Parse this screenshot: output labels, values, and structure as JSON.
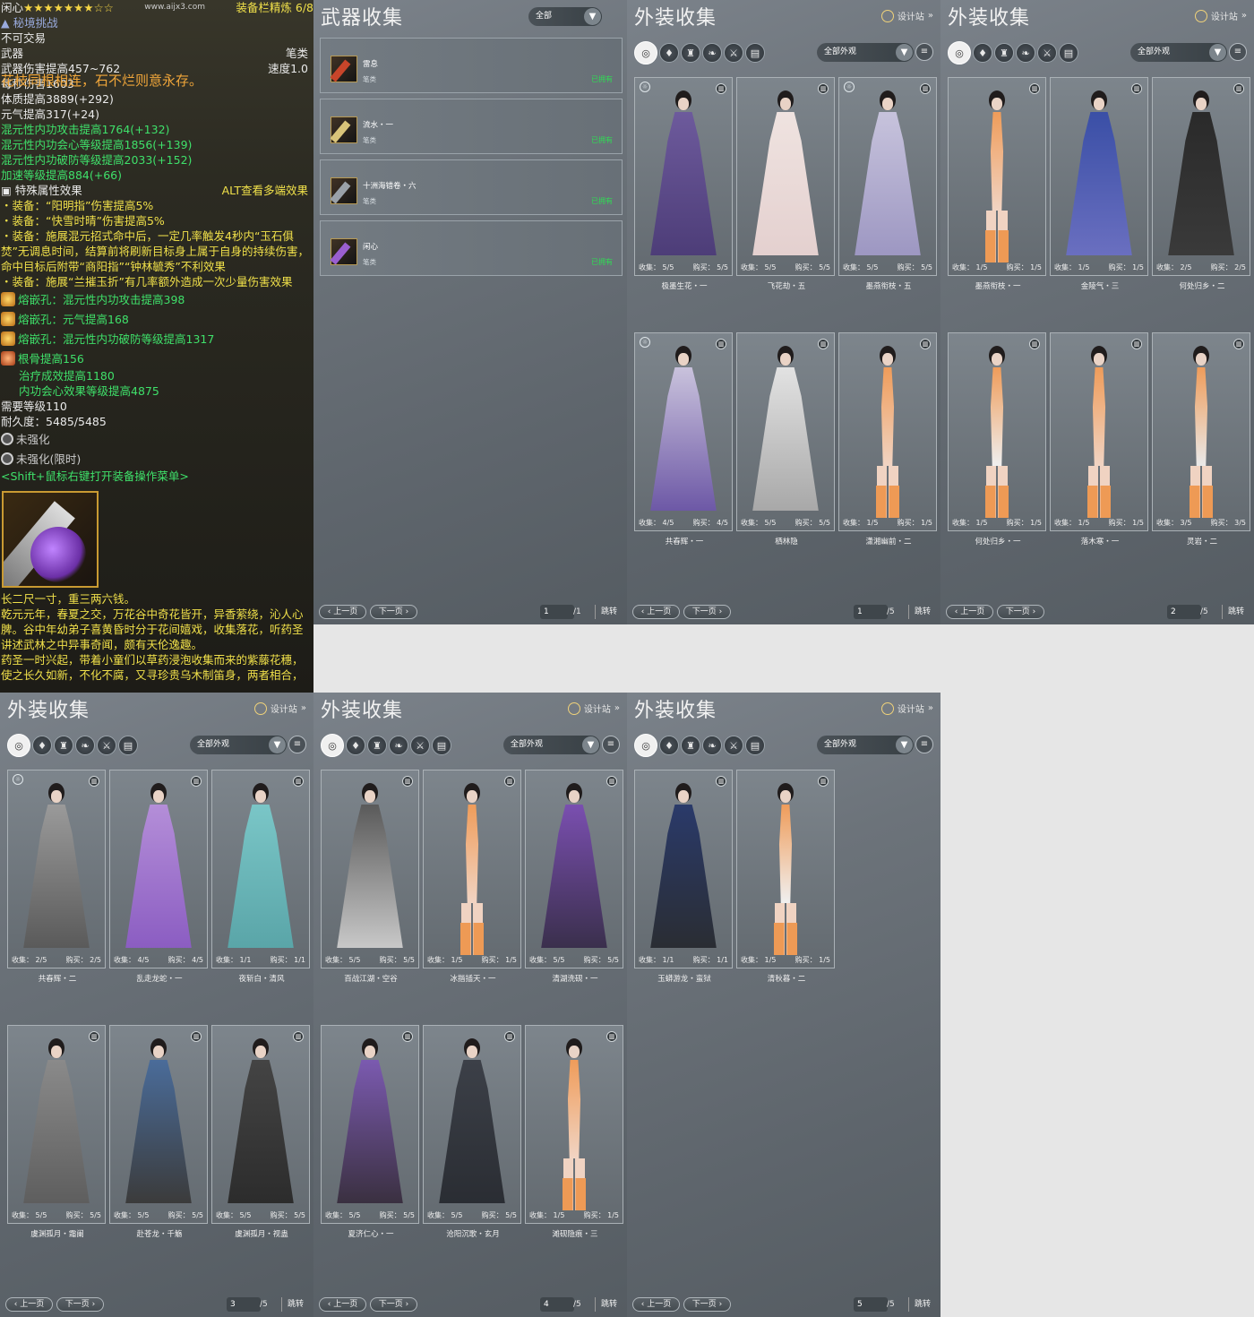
{
  "tooltip": {
    "watermark": "www.aijx3.com",
    "name": "闲心",
    "stars": "★★★★★★★☆☆",
    "refine": "装备栏精炼 6/8",
    "challenge": "秘境挑战",
    "no_trade": "不可交易",
    "slot": "武器",
    "weapon_type": "笔类",
    "damage": "武器伤害提高457~762",
    "speed": "速度1.0",
    "motto": "花枝同根相连，石不烂则意永存。",
    "dps_line": "每秒伤害1603",
    "lines": [
      {
        "text": "体质提高3889(+292)",
        "c": "w"
      },
      {
        "text": "元气提高317(+24)",
        "c": "w"
      },
      {
        "text": "混元性内功攻击提高1764(+132)",
        "c": "g"
      },
      {
        "text": "混元性内功会心等级提高1856(+139)",
        "c": "g"
      },
      {
        "text": "混元性内功破防等级提高2033(+152)",
        "c": "g"
      },
      {
        "text": "加速等级提高884(+66)",
        "c": "g"
      }
    ],
    "special_label": "特殊属性效果",
    "alt_hint": "ALT查看多端效果",
    "effects": [
      "・装备：“阳明指”伤害提高5%",
      "・装备：“快雪时晴”伤害提高5%",
      "・装备：施展混元招式命中后，一定几率触发4秒内“玉石俱焚”无调息时间，结算前将刷新目标身上属于自身的持续伤害，命中目标后附带“商阳指”“钟林毓秀”不利效果",
      "・装备：施展“兰摧玉折”有几率额外造成一次少量伤害效果"
    ],
    "gems": [
      "熔嵌孔：混元性内功攻击提高398",
      "熔嵌孔：元气提高168",
      "熔嵌孔：混元性内功破防等级提高1317"
    ],
    "enchant_main": "根骨提高156",
    "enchant_sub1": "治疗成效提高1180",
    "enchant_sub2": "内功会心效果等级提高4875",
    "level": "需要等级110",
    "durability": "耐久度：5485/5485",
    "unenhanced": "未强化",
    "unenhanced_limited": "未强化(限时)",
    "shift_hint": "<Shift+鼠标右键打开装备操作菜单>",
    "desc1": "长二尺一寸，重三两六钱。",
    "desc2": "乾元元年，春夏之交，万花谷中奇花皆开，异香萦绕，沁人心脾。谷中年幼弟子喜黄昏时分于花间嬉戏，收集落花，听药圣讲述武林之中异事奇闻，颇有天伦逸趣。",
    "desc3": "药圣一时兴起，带着小童们以草药浸泡收集而来的紫藤花穗，使之长久如新，不化不腐，又寻珍贵乌木制笛身，两者相合，"
  },
  "weapon_panel": {
    "title": "武器收集",
    "filter": "全部",
    "items": [
      {
        "name": "雷息",
        "type": "笔类",
        "status": "已拥有",
        "color": "#c8452a"
      },
      {
        "name": "流水・一",
        "type": "笔类",
        "status": "已拥有",
        "color": "#d9c47a"
      },
      {
        "name": "十洲海错卷・六",
        "type": "笔类",
        "status": "已拥有",
        "color": "#9aa1a8"
      },
      {
        "name": "闲心",
        "type": "笔类",
        "status": "已拥有",
        "color": "#9a5fd0"
      }
    ],
    "page": "1",
    "total": "/1"
  },
  "ui": {
    "designer": "设计站",
    "filter": "全部外观",
    "prev": "上一页",
    "next": "下一页",
    "jump": "跳转",
    "collect": "收集：",
    "buy": "购买："
  },
  "outfit_panels": [
    {
      "title": "外装收集",
      "page": "1",
      "total": "/5",
      "cards": [
        {
          "name": "极墨生花・一",
          "collect": "5/5",
          "buy": "5/5",
          "top": "#6d5a9c",
          "bot": "#4d3d78",
          "tl": true
        },
        {
          "name": "飞花劫・五",
          "collect": "5/5",
          "buy": "5/5",
          "top": "#efe3e0",
          "bot": "#e4d0cf",
          "tl": false
        },
        {
          "name": "墨燕衔枝・五",
          "collect": "5/5",
          "buy": "5/5",
          "top": "#c7c3dc",
          "bot": "#9d97c2",
          "tl": true
        },
        {
          "name": "共春辉・一",
          "collect": "4/5",
          "buy": "4/5",
          "top": "#c9c2dc",
          "bot": "#6d58a6",
          "tl": true
        },
        {
          "name": "栖林隐",
          "collect": "5/5",
          "buy": "5/5",
          "top": "#e2e2e2",
          "bot": "#a8a8a8",
          "tl": false
        },
        {
          "name": "潇湘幽前・二",
          "collect": "1/5",
          "buy": "1/5",
          "top": "#ef9c5a",
          "bot": "#f1d4c3",
          "tl": false,
          "slim": true
        }
      ]
    },
    {
      "title": "外装收集",
      "page": "2",
      "total": "/5",
      "cards": [
        {
          "name": "墨燕衔枝・一",
          "collect": "1/5",
          "buy": "1/5",
          "top": "#ef9c5a",
          "bot": "#f1d4c3",
          "tl": false,
          "slim": true
        },
        {
          "name": "金陵气・三",
          "collect": "1/5",
          "buy": "1/5",
          "top": "#3a4fa6",
          "bot": "#6a6fc0",
          "tl": false
        },
        {
          "name": "何处归乡・二",
          "collect": "2/5",
          "buy": "2/5",
          "top": "#2a2a2a",
          "bot": "#3a3a3a",
          "tl": false
        },
        {
          "name": "何处归乡・一",
          "collect": "1/5",
          "buy": "1/5",
          "top": "#ef9c5a",
          "bot": "#efefef",
          "tl": false,
          "slim": true
        },
        {
          "name": "落木寒・一",
          "collect": "1/5",
          "buy": "1/5",
          "top": "#ef9c5a",
          "bot": "#f1d4c3",
          "tl": false,
          "slim": true
        },
        {
          "name": "灵岩・二",
          "collect": "3/5",
          "buy": "3/5",
          "top": "#ef9c5a",
          "bot": "#e9e9e9",
          "tl": false,
          "slim": true
        }
      ]
    },
    {
      "title": "外装收集",
      "page": "3",
      "total": "/5",
      "cards": [
        {
          "name": "共春辉・二",
          "collect": "2/5",
          "buy": "2/5",
          "top": "#9a9a9a",
          "bot": "#5a5a5a",
          "tl": true
        },
        {
          "name": "乱走龙蛇・一",
          "collect": "4/5",
          "buy": "4/5",
          "top": "#b48ed8",
          "bot": "#8b5dc2",
          "tl": false
        },
        {
          "name": "夜斩白・清风",
          "collect": "1/1",
          "buy": "1/1",
          "top": "#7ac6c7",
          "bot": "#5aa5a8",
          "tl": false
        },
        {
          "name": "虞渊孤月・霜阑",
          "collect": "5/5",
          "buy": "5/5",
          "top": "#8a8a8a",
          "bot": "#5e5e5e",
          "tl": false
        },
        {
          "name": "赴苍龙・千觞",
          "collect": "5/5",
          "buy": "5/5",
          "top": "#4a6c9a",
          "bot": "#3b3b3b",
          "tl": false
        },
        {
          "name": "虞渊孤月・视蛊",
          "collect": "5/5",
          "buy": "5/5",
          "top": "#444",
          "bot": "#2c2c2c",
          "tl": false
        }
      ]
    },
    {
      "title": "外装收集",
      "page": "4",
      "total": "/5",
      "cards": [
        {
          "name": "百战江湖・空谷",
          "collect": "5/5",
          "buy": "5/5",
          "top": "#5a5a5a",
          "bot": "#c8c8c8",
          "tl": false
        },
        {
          "name": "冰揩插天・一",
          "collect": "1/5",
          "buy": "1/5",
          "top": "#ef9c5a",
          "bot": "#f1d4c3",
          "tl": false,
          "slim": true
        },
        {
          "name": "清湖洗砚・一",
          "collect": "5/5",
          "buy": "5/5",
          "top": "#7a4fb0",
          "bot": "#3a2f4c",
          "tl": false
        },
        {
          "name": "夏济仁心・一",
          "collect": "5/5",
          "buy": "5/5",
          "top": "#7b5ab0",
          "bot": "#3a3040",
          "tl": false
        },
        {
          "name": "沧阳沉歌・玄月",
          "collect": "5/5",
          "buy": "5/5",
          "top": "#3c4048",
          "bot": "#2a2d33",
          "tl": false
        },
        {
          "name": "滩砚隐痕・三",
          "collect": "1/5",
          "buy": "1/5",
          "top": "#ef9c5a",
          "bot": "#f1d4c3",
          "tl": false,
          "slim": true
        }
      ]
    },
    {
      "title": "外装收集",
      "page": "5",
      "total": "/5",
      "cards": [
        {
          "name": "玉蟒游龙・蛮狱",
          "collect": "1/1",
          "buy": "1/1",
          "top": "#2a3a6a",
          "bot": "#2a2d33",
          "tl": false
        },
        {
          "name": "清秋暮・二",
          "collect": "1/5",
          "buy": "1/5",
          "top": "#ef9c5a",
          "bot": "#f0f0f0",
          "tl": false,
          "slim": true
        }
      ]
    }
  ]
}
